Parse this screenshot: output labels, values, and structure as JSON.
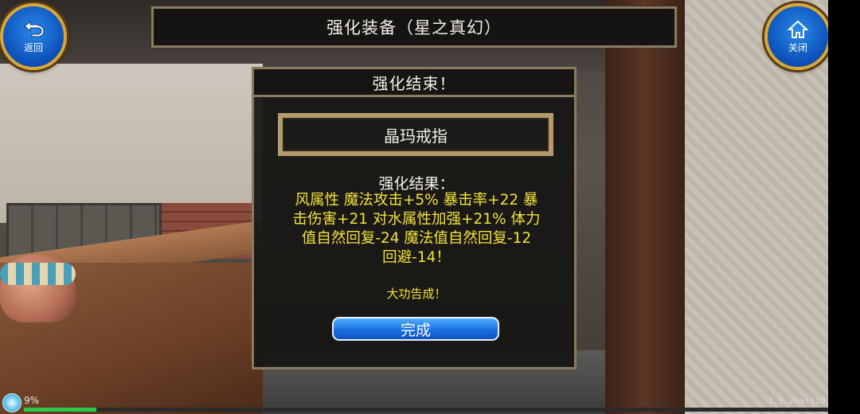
{
  "header": {
    "title": "强化装备（星之真幻）",
    "back_label": "返回",
    "close_label": "关闭"
  },
  "dialog": {
    "title": "强化结束！",
    "item_name": "晶玛戒指",
    "result_heading": "强化结果：",
    "result_lines": [
      "风属性 魔法攻击+5% 暴击率+22 暴",
      "击伤害+21 对水属性加强+21% 体力",
      "值自然回复-24 魔法值自然回复-12",
      "回避-14！"
    ],
    "success_text": "大功告成！",
    "confirm_label": "完成"
  },
  "footer": {
    "battery_text": "9%",
    "progress_fraction": 0.09,
    "version": "3.5.20a(110)"
  },
  "colors": {
    "result_text": "#f3e23a",
    "button_blue": "#1a6fe0",
    "frame_gold": "#8a7a60"
  },
  "icons": {
    "back": "return-arrow-icon",
    "close": "home-icon",
    "status": "refresh-icon"
  }
}
